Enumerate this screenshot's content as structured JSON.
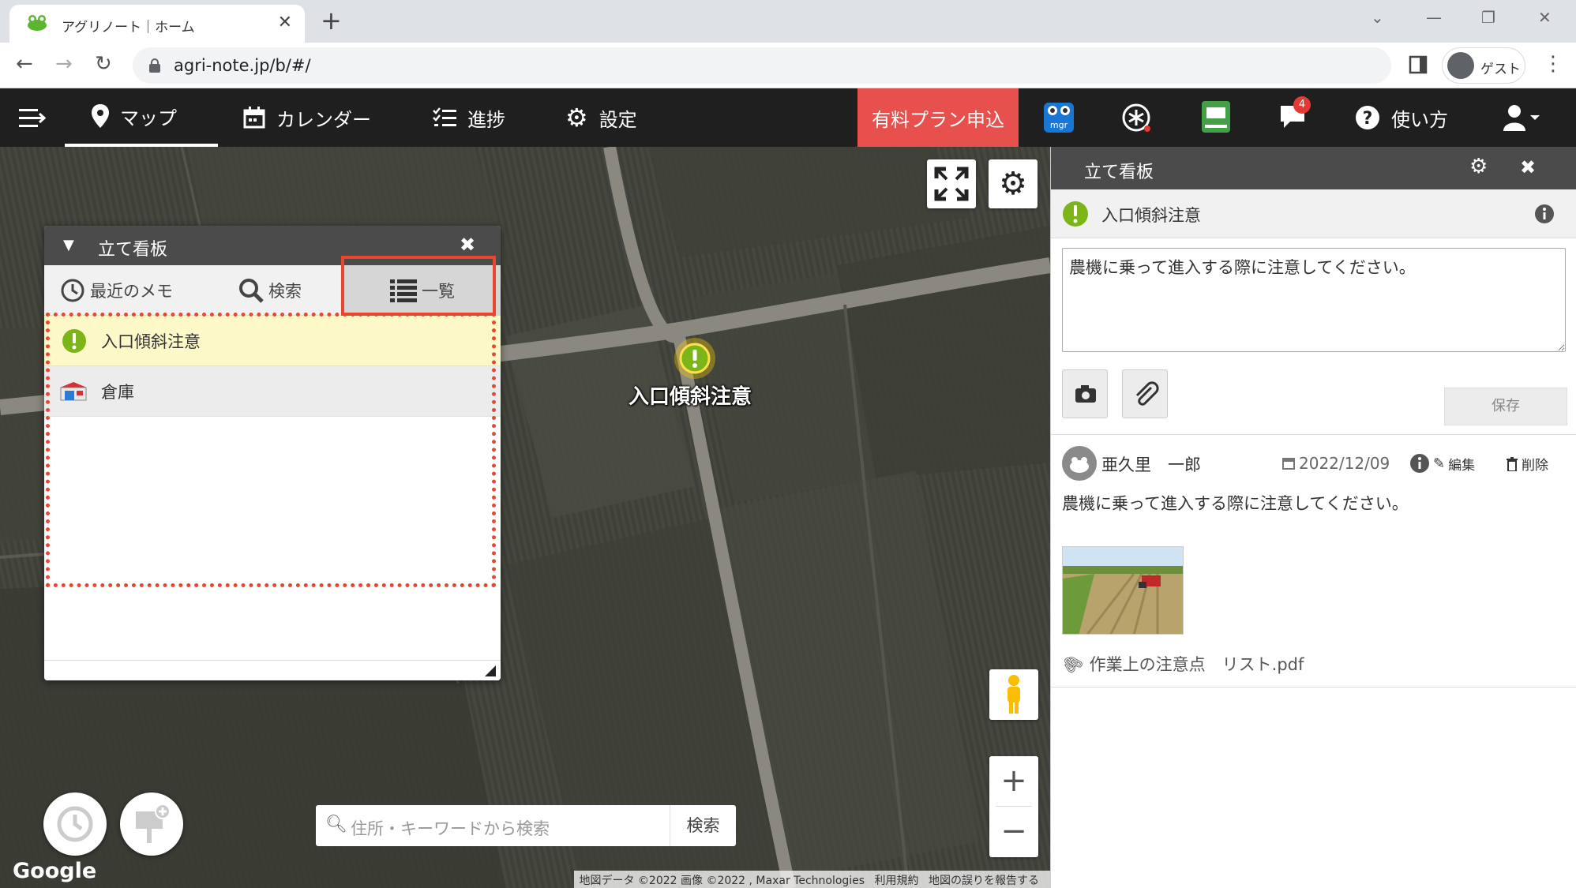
{
  "browser": {
    "tab_title": "アグリノート｜ホーム",
    "url": "agri-note.jp/b/#/",
    "profile_label": "ゲスト"
  },
  "nav": {
    "items": [
      {
        "label": "マップ",
        "icon": "map-pin-icon"
      },
      {
        "label": "カレンダー",
        "icon": "calendar-icon"
      },
      {
        "label": "進捗",
        "icon": "checklist-icon"
      },
      {
        "label": "設定",
        "icon": "gear-icon"
      }
    ],
    "paid_plan": "有料プラン申込",
    "notification_count": "4",
    "help": "使い方",
    "icon_labels": {
      "mgr": "mgr"
    }
  },
  "map": {
    "pin_label": "入口傾斜注意",
    "search_placeholder": "住所・キーワードから検索",
    "search_button": "検索",
    "google": "Google",
    "attribution": [
      "地図データ ©2022 画像 ©2022 , Maxar Technologies",
      "利用規約",
      "地図の誤りを報告する"
    ],
    "zoom_in": "+",
    "zoom_out": "−"
  },
  "panel": {
    "title": "立て看板",
    "tabs": [
      {
        "label": "最近のメモ",
        "icon": "clock-icon"
      },
      {
        "label": "検索",
        "icon": "search-icon"
      },
      {
        "label": "一覧",
        "icon": "list-icon",
        "active": true
      }
    ],
    "items": [
      {
        "label": "入口傾斜注意",
        "icon": "warning-icon",
        "selected": true
      },
      {
        "label": "倉庫",
        "icon": "warehouse-icon"
      }
    ]
  },
  "detail": {
    "title": "立て看板",
    "item_title": "入口傾斜注意",
    "memo_value": "農機に乗って進入する際に注意してください。",
    "save": "保存",
    "entry": {
      "author": "亜久里　一郎",
      "date": "2022/12/09",
      "edit": "編集",
      "delete": "削除",
      "text": "農機に乗って進入する際に注意してください。",
      "attachment": "作業上の注意点　リスト.pdf"
    }
  },
  "colors": {
    "nav_bg": "#1f1f1f",
    "paid_bg": "#e8504e",
    "panel_head": "#4b4b4b",
    "warning_green": "#7cb518",
    "highlight": "#e8472f",
    "selected_row": "#fdf8c8"
  }
}
